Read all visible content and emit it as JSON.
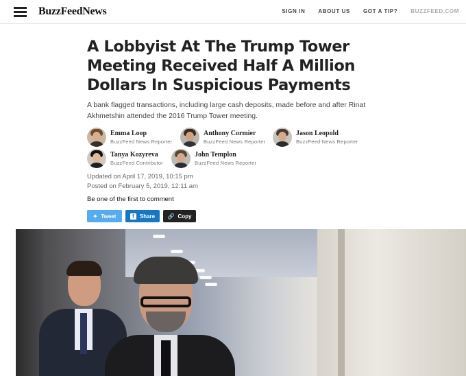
{
  "header": {
    "logo": "BuzzFeedNews",
    "nav": [
      {
        "label": "SIGN IN"
      },
      {
        "label": "ABOUT US"
      },
      {
        "label": "GOT A TIP?"
      },
      {
        "label": "BUZZFEED.COM"
      }
    ]
  },
  "article": {
    "title": "A Lobbyist At The Trump Tower Meeting Received Half A Million Dollars In Suspicious Payments",
    "dek": "A bank flagged transactions, including large cash deposits, made before and after Rinat Akhmetshin attended the 2016 Trump Tower meeting.",
    "authors": [
      {
        "name": "Emma Loop",
        "role": "BuzzFeed News Reporter"
      },
      {
        "name": "Anthony Cormier",
        "role": "BuzzFeed News Reporter"
      },
      {
        "name": "Jason Leopold",
        "role": "BuzzFeed News Reporter"
      },
      {
        "name": "Tanya Kozyreva",
        "role": "BuzzFeed Contributor"
      },
      {
        "name": "John Templon",
        "role": "BuzzFeed News Reporter"
      }
    ],
    "updated": "Updated on April 17, 2019, 10:15 pm",
    "posted": "Posted on February 5, 2019, 12:11 am",
    "comment_prompt": "Be one of the first to comment"
  },
  "share": {
    "tweet": "Tweet",
    "facebook": "Share",
    "copy": "Copy"
  },
  "colors": {
    "twitter": "#55acee",
    "facebook": "#1877c2",
    "copy": "#222222"
  }
}
